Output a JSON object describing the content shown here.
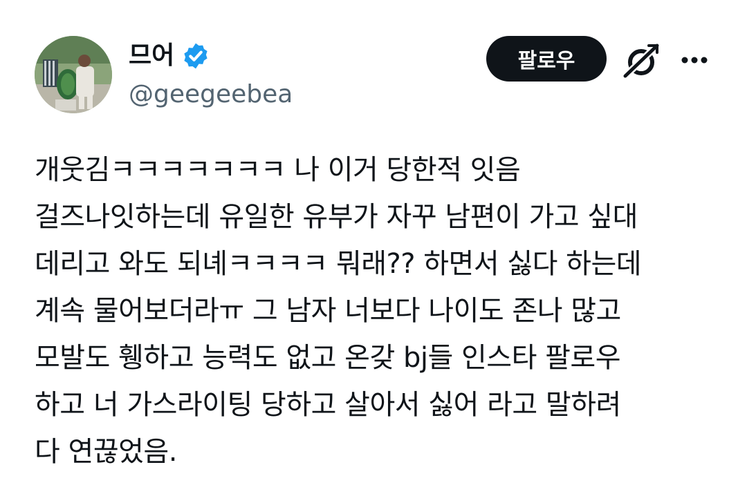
{
  "user": {
    "display_name": "므어",
    "handle": "@geegeebea"
  },
  "header": {
    "follow_label": "팔로우"
  },
  "tweet": {
    "lines": [
      "개웃김ㅋㅋㅋㅋㅋㅋㅋ 나 이거 당한적 잇음",
      "걸즈나잇하는데 유일한 유부가 자꾸 남편이 가고 싶대",
      "데리고 와도 되녜ㅋㅋㅋㅋ 뭐래?? 하면서 싫다 하는데",
      "계속 물어보더라ㅠ 그 남자 너보다 나이도 존나 많고",
      "모발도 휑하고 능력도 없고 온갖 bj들 인스타 팔로우",
      "하고 너 가스라이팅 당하고 살아서 싫어 라고 말하려",
      "다 연끊었음."
    ]
  },
  "icons": {
    "verified": "verified-badge-icon",
    "grok": "grok-icon",
    "more": "more-options-icon"
  },
  "colors": {
    "text": "#0f1419",
    "secondary_text": "#536471",
    "verified_blue": "#1d9bf0",
    "follow_button_bg": "#0f1419",
    "follow_button_text": "#ffffff"
  }
}
